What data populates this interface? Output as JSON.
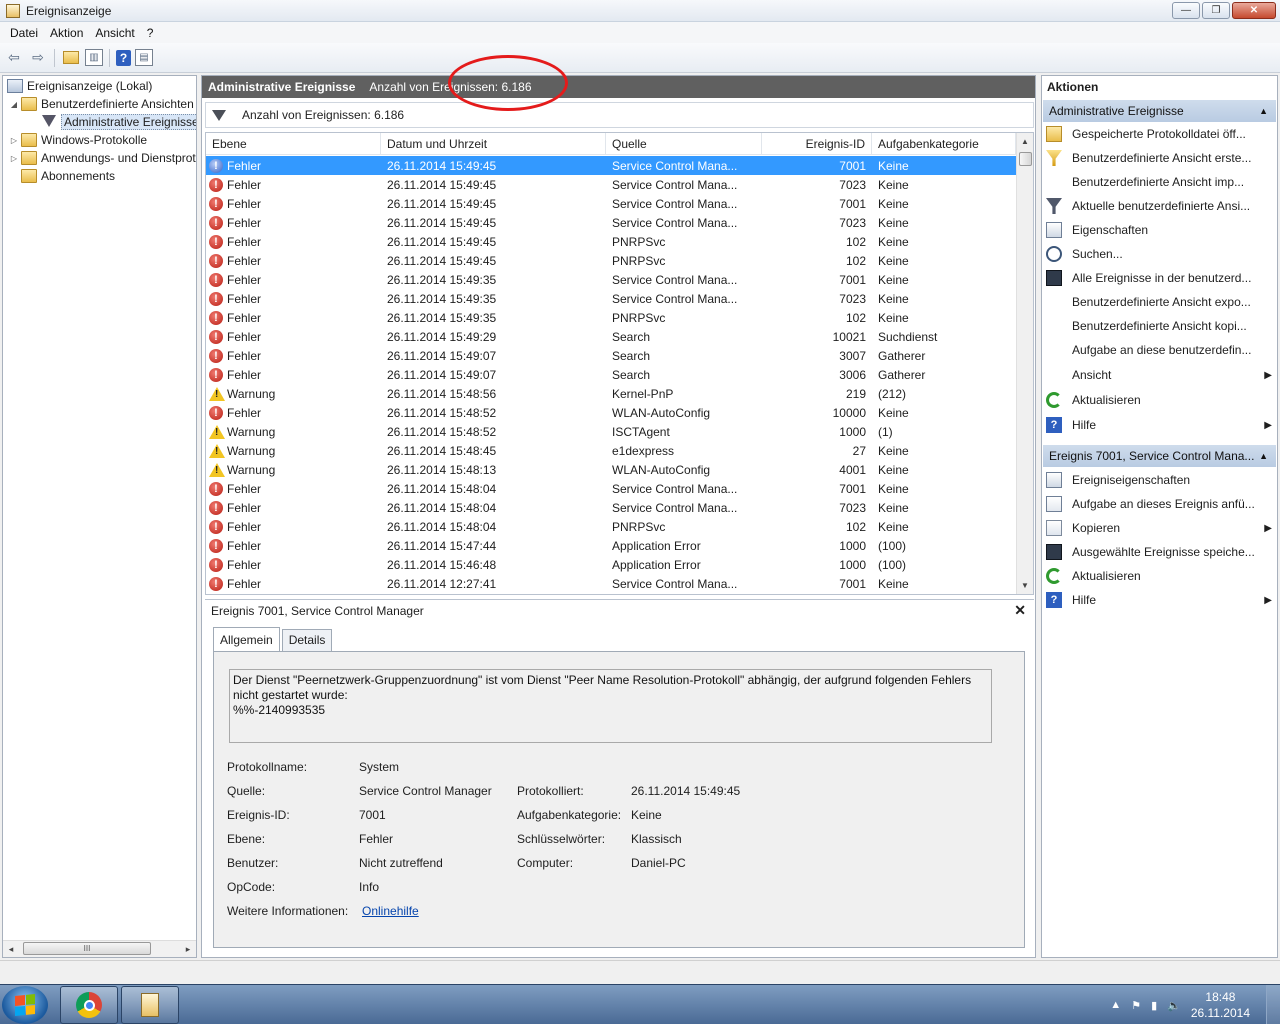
{
  "window": {
    "title": "Ereignisanzeige",
    "controls": {
      "minimize": "—",
      "maximize": "❐",
      "close": "✕"
    }
  },
  "menu": [
    "Datei",
    "Aktion",
    "Ansicht",
    "?"
  ],
  "toolbar": {
    "icons": [
      "back-icon",
      "forward-icon",
      "up-folder-icon",
      "show-hide-tree-icon",
      "help-icon",
      "show-hide-action-pane-icon"
    ],
    "help_label": "?"
  },
  "tree": {
    "root": "Ereignisanzeige (Lokal)",
    "custom_views": "Benutzerdefinierte Ansichten",
    "admin_events": "Administrative Ereignisse",
    "windows_logs": "Windows-Protokolle",
    "app_service_logs": "Anwendungs- und Dienstprotokolle",
    "subscriptions": "Abonnements",
    "expand_glyphs": {
      "expanded": "◢",
      "collapsed": "▷"
    },
    "scrollbar": {
      "left": "◂",
      "right": "▸",
      "thumb": "III"
    }
  },
  "center": {
    "header_title": "Administrative Ereignisse",
    "header_count": "Anzahl von Ereignissen: 6.186",
    "filter_text": "Anzahl von Ereignissen: 6.186",
    "columns": [
      "Ebene",
      "Datum und Uhrzeit",
      "Quelle",
      "Ereignis-ID",
      "Aufgabenkategorie"
    ],
    "rows": [
      {
        "level": "Fehler",
        "type": "error",
        "date": "26.11.2014 15:49:45",
        "source": "Service Control Mana...",
        "id": "7001",
        "category": "Keine"
      },
      {
        "level": "Fehler",
        "type": "error",
        "date": "26.11.2014 15:49:45",
        "source": "Service Control Mana...",
        "id": "7023",
        "category": "Keine"
      },
      {
        "level": "Fehler",
        "type": "error",
        "date": "26.11.2014 15:49:45",
        "source": "Service Control Mana...",
        "id": "7001",
        "category": "Keine"
      },
      {
        "level": "Fehler",
        "type": "error",
        "date": "26.11.2014 15:49:45",
        "source": "Service Control Mana...",
        "id": "7023",
        "category": "Keine"
      },
      {
        "level": "Fehler",
        "type": "error",
        "date": "26.11.2014 15:49:45",
        "source": "PNRPSvc",
        "id": "102",
        "category": "Keine"
      },
      {
        "level": "Fehler",
        "type": "error",
        "date": "26.11.2014 15:49:45",
        "source": "PNRPSvc",
        "id": "102",
        "category": "Keine"
      },
      {
        "level": "Fehler",
        "type": "error",
        "date": "26.11.2014 15:49:35",
        "source": "Service Control Mana...",
        "id": "7001",
        "category": "Keine"
      },
      {
        "level": "Fehler",
        "type": "error",
        "date": "26.11.2014 15:49:35",
        "source": "Service Control Mana...",
        "id": "7023",
        "category": "Keine"
      },
      {
        "level": "Fehler",
        "type": "error",
        "date": "26.11.2014 15:49:35",
        "source": "PNRPSvc",
        "id": "102",
        "category": "Keine"
      },
      {
        "level": "Fehler",
        "type": "error",
        "date": "26.11.2014 15:49:29",
        "source": "Search",
        "id": "10021",
        "category": "Suchdienst"
      },
      {
        "level": "Fehler",
        "type": "error",
        "date": "26.11.2014 15:49:07",
        "source": "Search",
        "id": "3007",
        "category": "Gatherer"
      },
      {
        "level": "Fehler",
        "type": "error",
        "date": "26.11.2014 15:49:07",
        "source": "Search",
        "id": "3006",
        "category": "Gatherer"
      },
      {
        "level": "Warnung",
        "type": "warning",
        "date": "26.11.2014 15:48:56",
        "source": "Kernel-PnP",
        "id": "219",
        "category": "(212)"
      },
      {
        "level": "Fehler",
        "type": "error",
        "date": "26.11.2014 15:48:52",
        "source": "WLAN-AutoConfig",
        "id": "10000",
        "category": "Keine"
      },
      {
        "level": "Warnung",
        "type": "warning",
        "date": "26.11.2014 15:48:52",
        "source": "ISCTAgent",
        "id": "1000",
        "category": "(1)"
      },
      {
        "level": "Warnung",
        "type": "warning",
        "date": "26.11.2014 15:48:45",
        "source": "e1dexpress",
        "id": "27",
        "category": "Keine"
      },
      {
        "level": "Warnung",
        "type": "warning",
        "date": "26.11.2014 15:48:13",
        "source": "WLAN-AutoConfig",
        "id": "4001",
        "category": "Keine"
      },
      {
        "level": "Fehler",
        "type": "error",
        "date": "26.11.2014 15:48:04",
        "source": "Service Control Mana...",
        "id": "7001",
        "category": "Keine"
      },
      {
        "level": "Fehler",
        "type": "error",
        "date": "26.11.2014 15:48:04",
        "source": "Service Control Mana...",
        "id": "7023",
        "category": "Keine"
      },
      {
        "level": "Fehler",
        "type": "error",
        "date": "26.11.2014 15:48:04",
        "source": "PNRPSvc",
        "id": "102",
        "category": "Keine"
      },
      {
        "level": "Fehler",
        "type": "error",
        "date": "26.11.2014 15:47:44",
        "source": "Application Error",
        "id": "1000",
        "category": "(100)"
      },
      {
        "level": "Fehler",
        "type": "error",
        "date": "26.11.2014 15:46:48",
        "source": "Application Error",
        "id": "1000",
        "category": "(100)"
      },
      {
        "level": "Fehler",
        "type": "error",
        "date": "26.11.2014 12:27:41",
        "source": "Service Control Mana...",
        "id": "7001",
        "category": "Keine"
      }
    ],
    "selected_row": 0,
    "scroll": {
      "up": "▲",
      "down": "▼"
    }
  },
  "details": {
    "title": "Ereignis 7001, Service Control Manager",
    "close": "✕",
    "tabs": [
      "Allgemein",
      "Details"
    ],
    "message": "Der Dienst \"Peernetzwerk-Gruppenzuordnung\" ist vom Dienst \"Peer Name Resolution-Protokoll\" abhängig, der aufgrund folgenden Fehlers\nnicht gestartet wurde:\n%%-2140993535",
    "labels": {
      "log_name": "Protokollname:",
      "source": "Quelle:",
      "event_id": "Ereignis-ID:",
      "level": "Ebene:",
      "user": "Benutzer:",
      "opcode": "OpCode:",
      "more_info": "Weitere Informationen:",
      "logged": "Protokolliert:",
      "task_category": "Aufgabenkategorie:",
      "keywords": "Schlüsselwörter:",
      "computer": "Computer:"
    },
    "values": {
      "log_name": "System",
      "source": "Service Control Manager",
      "event_id": "7001",
      "level": "Fehler",
      "user": "Nicht zutreffend",
      "opcode": "Info",
      "more_info": "Onlinehilfe",
      "logged": "26.11.2014 15:49:45",
      "task_category": "Keine",
      "keywords": "Klassisch",
      "computer": "Daniel-PC"
    }
  },
  "actions": {
    "title": "Aktionen",
    "section1": "Administrative Ereignisse",
    "section1_items": [
      {
        "label": "Gespeicherte Protokolldatei öff...",
        "icon": "open-folder-icon",
        "submenu": false
      },
      {
        "label": "Benutzerdefinierte Ansicht erste...",
        "icon": "create-filter-icon",
        "submenu": false
      },
      {
        "label": "Benutzerdefinierte Ansicht imp...",
        "icon": "blank",
        "submenu": false
      },
      {
        "label": "Aktuelle benutzerdefinierte Ansi...",
        "icon": "filter-icon",
        "submenu": false
      },
      {
        "label": "Eigenschaften",
        "icon": "properties-icon",
        "submenu": false
      },
      {
        "label": "Suchen...",
        "icon": "find-icon",
        "submenu": false
      },
      {
        "label": "Alle Ereignisse in der benutzerd...",
        "icon": "save-icon",
        "submenu": false
      },
      {
        "label": "Benutzerdefinierte Ansicht expo...",
        "icon": "blank",
        "submenu": false
      },
      {
        "label": "Benutzerdefinierte Ansicht kopi...",
        "icon": "blank",
        "submenu": false
      },
      {
        "label": "Aufgabe an diese benutzerdefin...",
        "icon": "blank",
        "submenu": false
      },
      {
        "label": "Ansicht",
        "icon": "blank",
        "submenu": true
      },
      {
        "label": "Aktualisieren",
        "icon": "refresh-icon",
        "submenu": false
      },
      {
        "label": "Hilfe",
        "icon": "help-icon",
        "submenu": true
      }
    ],
    "section2": "Ereignis 7001, Service Control Mana...",
    "section2_items": [
      {
        "label": "Ereigniseigenschaften",
        "icon": "event-properties-icon",
        "submenu": false
      },
      {
        "label": "Aufgabe an dieses Ereignis anfü...",
        "icon": "attach-task-icon",
        "submenu": false
      },
      {
        "label": "Kopieren",
        "icon": "copy-icon",
        "submenu": true
      },
      {
        "label": "Ausgewählte Ereignisse speiche...",
        "icon": "save-icon",
        "submenu": false
      },
      {
        "label": "Aktualisieren",
        "icon": "refresh-icon",
        "submenu": false
      },
      {
        "label": "Hilfe",
        "icon": "help-icon",
        "submenu": true
      }
    ],
    "caret": "▲",
    "submenu_arrow": "▶"
  },
  "taskbar": {
    "clock_time": "18:48",
    "clock_date": "26.11.2014",
    "tray_icons": [
      "show-hidden-icons-icon",
      "action-center-flag-icon",
      "network-icon",
      "volume-icon"
    ],
    "tray_glyphs": {
      "show_hidden": "▲",
      "flag": "⚑",
      "network": "▮",
      "volume": "🔈"
    }
  },
  "colors": {
    "selection": "#3399ff",
    "header_bg": "#606060",
    "section_bg": "#b9cbe2",
    "annotation": "#e41b1b"
  }
}
